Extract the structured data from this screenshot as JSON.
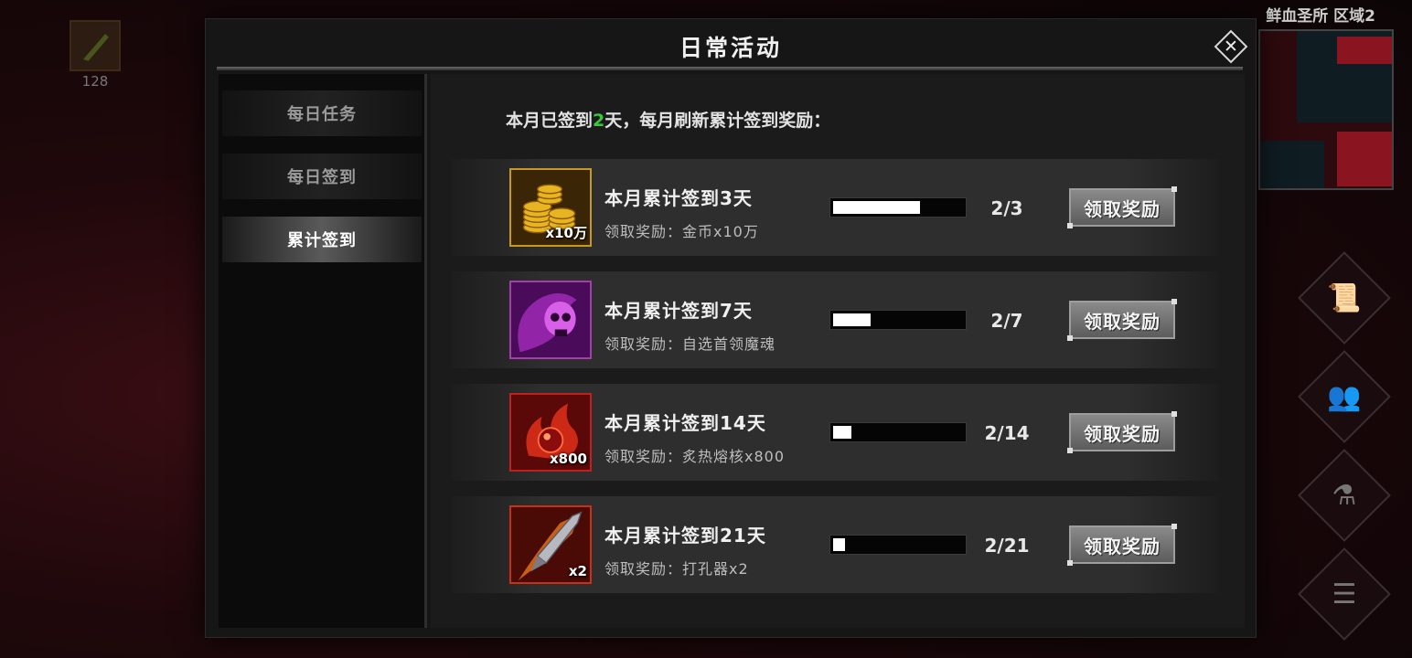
{
  "background": {
    "item_count": "128",
    "zone_label": "鲜血圣所 区域2",
    "side_buttons": [
      {
        "icon": "scroll-icon",
        "glyph": "📜"
      },
      {
        "icon": "people-icon",
        "glyph": "👥"
      },
      {
        "icon": "potion-icon",
        "glyph": "⚗"
      },
      {
        "icon": "menu-icon",
        "glyph": "☰"
      }
    ]
  },
  "modal": {
    "title": "日常活动",
    "close_icon": "✕"
  },
  "sidebar": {
    "tabs": [
      {
        "label": "每日任务",
        "active": false
      },
      {
        "label": "每日签到",
        "active": false
      },
      {
        "label": "累计签到",
        "active": true
      }
    ]
  },
  "summary": {
    "prefix": "本月已签到",
    "days": "2",
    "suffix": "天，每月刷新累计签到奖励："
  },
  "rewards": [
    {
      "title": "本月累计签到3天",
      "reward": "领取奖励：金币x10万",
      "icon": "gold-coins-icon",
      "qty": "x10万",
      "progress_text": "2/3",
      "progress": 0.667,
      "button": "领取奖励",
      "frame_color": "#c89a1c"
    },
    {
      "title": "本月累计签到7天",
      "reward": "领取奖励：自选首领魔魂",
      "icon": "purple-skull-soul-icon",
      "qty": "",
      "progress_text": "2/7",
      "progress": 0.286,
      "button": "领取奖励",
      "frame_color": "#a040a8"
    },
    {
      "title": "本月累计签到14天",
      "reward": "领取奖励：炙热熔核x800",
      "icon": "fire-core-icon",
      "qty": "x800",
      "progress_text": "2/14",
      "progress": 0.143,
      "button": "领取奖励",
      "frame_color": "#c02020"
    },
    {
      "title": "本月累计签到21天",
      "reward": "领取奖励：打孔器x2",
      "icon": "drill-blade-icon",
      "qty": "x2",
      "progress_text": "2/21",
      "progress": 0.095,
      "button": "领取奖励",
      "frame_color": "#c83018"
    }
  ]
}
